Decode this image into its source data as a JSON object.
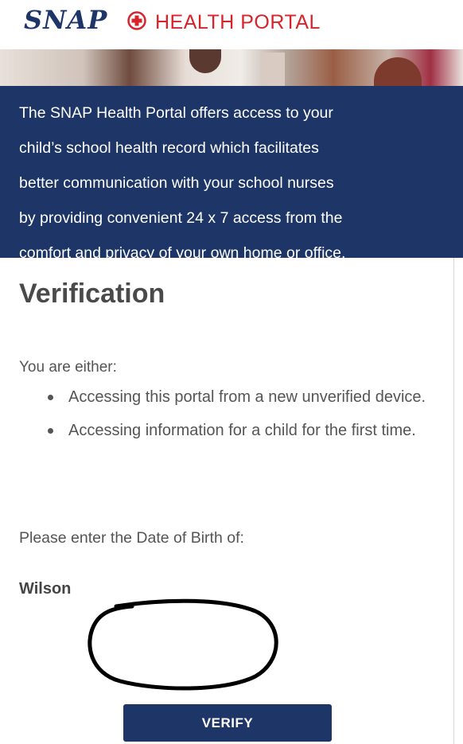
{
  "header": {
    "logo_brand": "SNAP",
    "logo_portal": "HEALTH PORTAL",
    "logo_icon": "medical-cross-icon"
  },
  "intro": {
    "text": "The SNAP Health Portal offers access to your\nchild’s school health record which facilitates\nbetter communication with your school nurses\nby providing convenient 24 x 7 access from the\ncomfort and privacy of your own home or office."
  },
  "verification": {
    "title": "Verification",
    "either_label": "You are either:",
    "reasons": [
      "Accessing this portal from a new unverified device.",
      "Accessing information for a child for the first time."
    ],
    "prompt": "Please enter the Date of Birth of:",
    "child_name": "Wilson",
    "dob_value": "",
    "verify_label": "VERIFY"
  },
  "colors": {
    "brand_navy": "#1d3567",
    "brand_red": "#d8232a"
  }
}
